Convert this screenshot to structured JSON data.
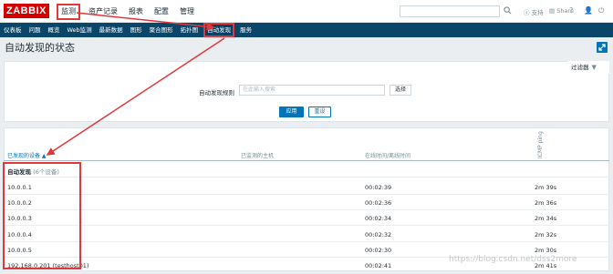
{
  "header": {
    "logo": "ZABBIX",
    "menu": [
      "监测",
      "资产记录",
      "报表",
      "配置",
      "管理"
    ],
    "support": "支持",
    "share": "Share",
    "help": "?",
    "user": "👤",
    "power": "⏻"
  },
  "submenu": [
    "仪表板",
    "问题",
    "概览",
    "Web监测",
    "最新数据",
    "图形",
    "聚合图形",
    "拓扑图",
    "自动发现",
    "服务"
  ],
  "page": {
    "title": "自动发现的状态"
  },
  "filter": {
    "tab_label": "过滤器",
    "rule_label": "自动发现规则",
    "rule_placeholder": "在此输入搜索",
    "select_label": "选择",
    "apply_label": "应用",
    "reset_label": "重设"
  },
  "table": {
    "columns": [
      "已发现的设备 ▲",
      "已监测的主机",
      "在线时间/离线时间",
      "ICMP ping"
    ],
    "group": {
      "name": "自动发现",
      "count": "(6个设备)"
    },
    "rows": [
      {
        "device": "10.0.0.1",
        "host": "",
        "uptime": "00:02:39",
        "icmp": "2m 39s"
      },
      {
        "device": "10.0.0.2",
        "host": "",
        "uptime": "00:02:36",
        "icmp": "2m 36s"
      },
      {
        "device": "10.0.0.3",
        "host": "",
        "uptime": "00:02:34",
        "icmp": "2m 34s"
      },
      {
        "device": "10.0.0.4",
        "host": "",
        "uptime": "00:02:32",
        "icmp": "2m 32s"
      },
      {
        "device": "10.0.0.5",
        "host": "",
        "uptime": "00:02:30",
        "icmp": "2m 30s"
      },
      {
        "device": "192.168.0.201 (testhost01)",
        "host": "",
        "uptime": "00:02:41",
        "icmp": "2m 41s"
      }
    ]
  },
  "watermark": "https://blog.csdn.net/dss2more",
  "colors": {
    "accent": "#0275b8",
    "navbar": "#0a466a",
    "highlight": "#e0383c",
    "brand": "#d40000"
  }
}
